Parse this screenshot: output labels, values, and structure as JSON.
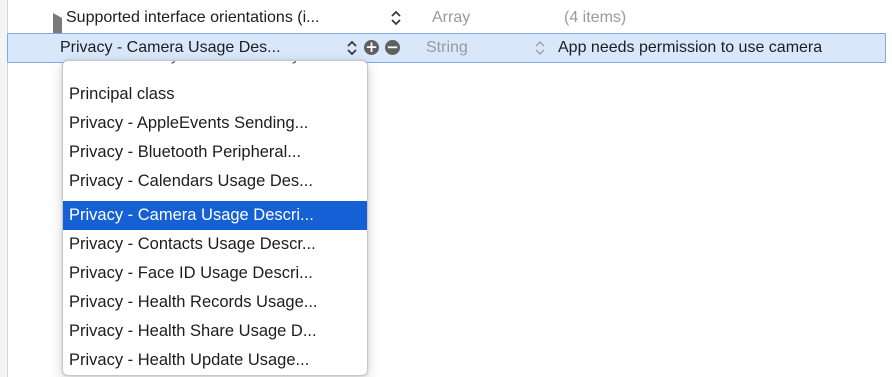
{
  "colors": {
    "selection": "#1560d4",
    "row_highlight": "#d9e7fb",
    "muted": "#9a9a9a"
  },
  "rows": [
    {
      "key": "Supported interface orientations (i...",
      "type": "Array",
      "value": "(4 items)",
      "expandable": true
    },
    {
      "key": "Privacy - Camera Usage Des...",
      "type": "String",
      "value": "App needs permission to use camera",
      "selected": true
    }
  ],
  "buttons": {
    "add": "+",
    "remove": "−"
  },
  "dropdown": {
    "partial_top": "Preferences sync exclusion keys",
    "items": [
      "Principal class",
      "Privacy - AppleEvents Sending...",
      "Privacy - Bluetooth Peripheral...",
      "Privacy - Calendars Usage Des...",
      "Privacy - Camera Usage Descri...",
      "Privacy - Contacts Usage Descr...",
      "Privacy - Face ID Usage Descri...",
      "Privacy - Health Records Usage...",
      "Privacy - Health Share Usage D...",
      "Privacy - Health Update Usage..."
    ],
    "selected_index": 4
  },
  "icons": [
    "disclosure-triangle-icon",
    "stepper-arrows-icon",
    "add-circle-icon",
    "remove-circle-icon"
  ]
}
